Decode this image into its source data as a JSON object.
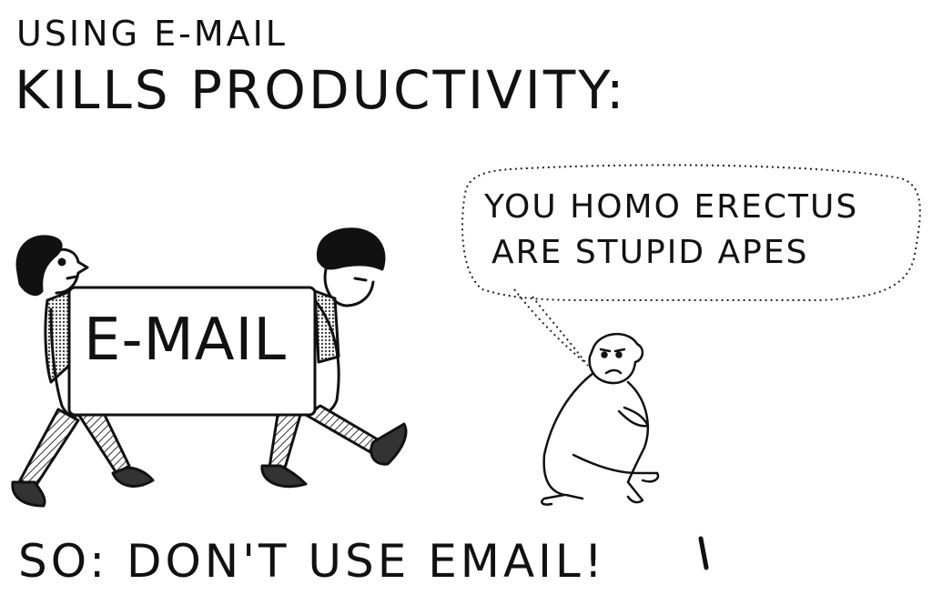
{
  "headline": {
    "line1": "USING E-MAIL",
    "line2": "KILLS PRODUCTIVITY:"
  },
  "speech_bubble": {
    "line1": "YOU HOMO ERECTUS",
    "line2": "ARE STUPID APES"
  },
  "sign": {
    "label": "E-MAIL"
  },
  "footer": {
    "text": "SO: DON'T USE EMAIL!"
  }
}
